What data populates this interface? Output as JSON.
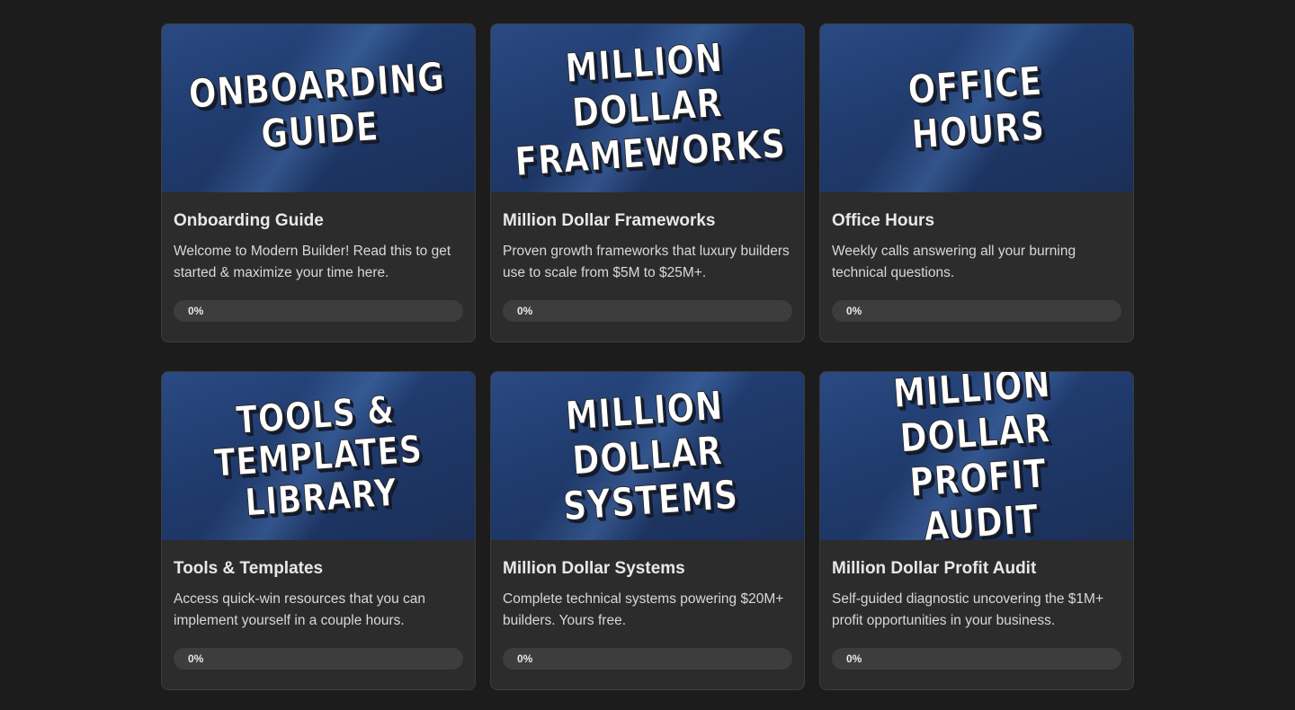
{
  "courses": [
    {
      "thumb_text": "ONBOARDING\nGUIDE",
      "title": "Onboarding Guide",
      "description": "Welcome to Modern Builder! Read this to get started & maximize your time here.",
      "progress_label": "0%",
      "progress_value": 0
    },
    {
      "thumb_text": "MILLION DOLLAR\nFRAMEWORKS",
      "title": "Million Dollar Frameworks",
      "description": "Proven growth frameworks that luxury builders use to scale from $5M to $25M+.",
      "progress_label": "0%",
      "progress_value": 0
    },
    {
      "thumb_text": "OFFICE\nHOURS",
      "title": "Office Hours",
      "description": "Weekly calls answering all your burning technical questions.",
      "progress_label": "0%",
      "progress_value": 0
    },
    {
      "thumb_text": "TOOLS &\nTEMPLATES\nLIBRARY",
      "title": "Tools & Templates",
      "description": "Access quick-win resources that you can implement yourself in a couple hours.",
      "progress_label": "0%",
      "progress_value": 0
    },
    {
      "thumb_text": "MILLION DOLLAR\nSYSTEMS",
      "title": "Million Dollar Systems",
      "description": "Complete technical systems powering $20M+ builders. Yours free.",
      "progress_label": "0%",
      "progress_value": 0
    },
    {
      "thumb_text": "MILLION DOLLAR\nPROFIT AUDIT",
      "title": "Million Dollar Profit Audit",
      "description": "Self-guided diagnostic uncovering the $1M+ profit opportunities in your business.",
      "progress_label": "0%",
      "progress_value": 0
    }
  ],
  "colors": {
    "page_background": "#1c1c1c",
    "card_background": "#2c2c2c",
    "thumbnail_blue": "#1f3a6c",
    "progress_track": "#3d3d3d"
  }
}
